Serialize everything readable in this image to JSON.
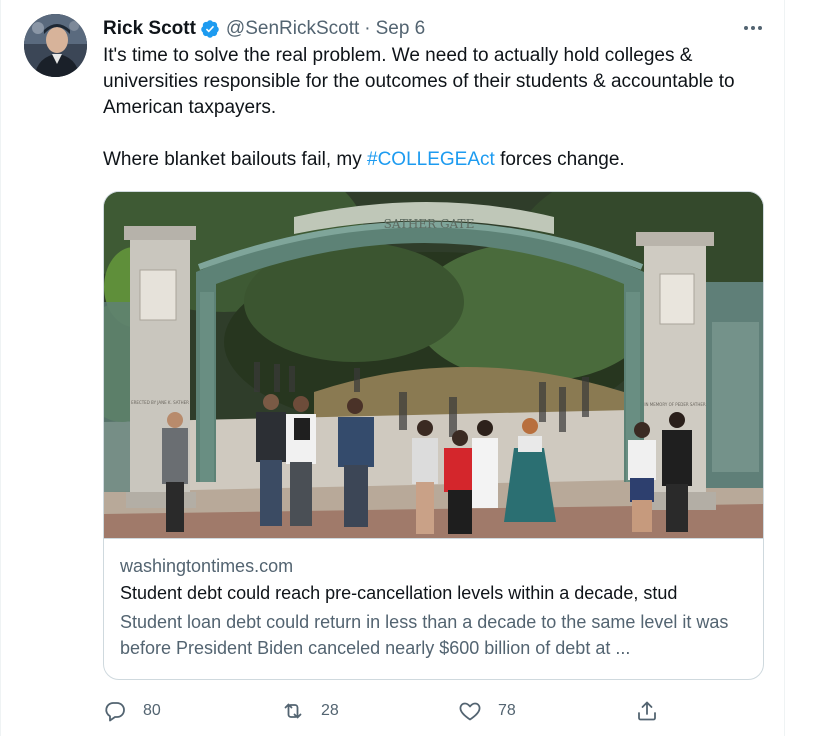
{
  "tweet": {
    "author_name": "Rick Scott",
    "handle": "@SenRickScott",
    "separator": "·",
    "date": "Sep 6",
    "text_line1": "It's time to solve the real problem. We need to actually hold colleges & universities responsible for the outcomes of their students & accountable to American taxpayers.",
    "text_line2_prefix": "Where blanket bailouts fail, my ",
    "hashtag": "#COLLEGEAct",
    "text_line2_suffix": " forces change."
  },
  "card": {
    "domain": "washingtontimes.com",
    "title": "Student debt could reach pre-cancellation levels within a decade, stud",
    "description": "Student loan debt could return in less than a decade to the same level it was before President Biden canceled nearly $600 billion of debt at ...",
    "image_arch_text": "SATHER GATE",
    "image_left_plaque": "ERECTED BY JANE K. SATHER",
    "image_right_plaque": "IN MEMORY OF PEDER SATHER"
  },
  "actions": {
    "reply_count": "80",
    "retweet_count": "28",
    "like_count": "78"
  },
  "colors": {
    "accent": "#1d9bf0",
    "secondary_text": "#536471",
    "border": "#cfd9de"
  },
  "icons": {
    "verified": "verified-badge-icon",
    "more": "more-options-icon",
    "reply": "reply-icon",
    "retweet": "retweet-icon",
    "like": "heart-icon",
    "share": "share-icon"
  }
}
